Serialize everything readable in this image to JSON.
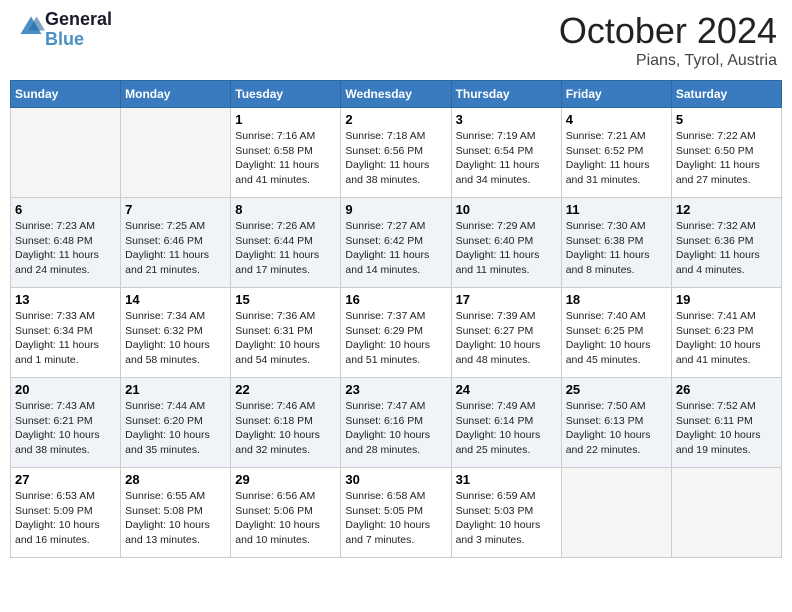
{
  "logo": {
    "text_general": "General",
    "text_blue": "Blue"
  },
  "header": {
    "month": "October 2024",
    "location": "Pians, Tyrol, Austria"
  },
  "weekdays": [
    "Sunday",
    "Monday",
    "Tuesday",
    "Wednesday",
    "Thursday",
    "Friday",
    "Saturday"
  ],
  "weeks": [
    [
      {
        "day": "",
        "info": ""
      },
      {
        "day": "",
        "info": ""
      },
      {
        "day": "1",
        "info": "Sunrise: 7:16 AM\nSunset: 6:58 PM\nDaylight: 11 hours and 41 minutes."
      },
      {
        "day": "2",
        "info": "Sunrise: 7:18 AM\nSunset: 6:56 PM\nDaylight: 11 hours and 38 minutes."
      },
      {
        "day": "3",
        "info": "Sunrise: 7:19 AM\nSunset: 6:54 PM\nDaylight: 11 hours and 34 minutes."
      },
      {
        "day": "4",
        "info": "Sunrise: 7:21 AM\nSunset: 6:52 PM\nDaylight: 11 hours and 31 minutes."
      },
      {
        "day": "5",
        "info": "Sunrise: 7:22 AM\nSunset: 6:50 PM\nDaylight: 11 hours and 27 minutes."
      }
    ],
    [
      {
        "day": "6",
        "info": "Sunrise: 7:23 AM\nSunset: 6:48 PM\nDaylight: 11 hours and 24 minutes."
      },
      {
        "day": "7",
        "info": "Sunrise: 7:25 AM\nSunset: 6:46 PM\nDaylight: 11 hours and 21 minutes."
      },
      {
        "day": "8",
        "info": "Sunrise: 7:26 AM\nSunset: 6:44 PM\nDaylight: 11 hours and 17 minutes."
      },
      {
        "day": "9",
        "info": "Sunrise: 7:27 AM\nSunset: 6:42 PM\nDaylight: 11 hours and 14 minutes."
      },
      {
        "day": "10",
        "info": "Sunrise: 7:29 AM\nSunset: 6:40 PM\nDaylight: 11 hours and 11 minutes."
      },
      {
        "day": "11",
        "info": "Sunrise: 7:30 AM\nSunset: 6:38 PM\nDaylight: 11 hours and 8 minutes."
      },
      {
        "day": "12",
        "info": "Sunrise: 7:32 AM\nSunset: 6:36 PM\nDaylight: 11 hours and 4 minutes."
      }
    ],
    [
      {
        "day": "13",
        "info": "Sunrise: 7:33 AM\nSunset: 6:34 PM\nDaylight: 11 hours and 1 minute."
      },
      {
        "day": "14",
        "info": "Sunrise: 7:34 AM\nSunset: 6:32 PM\nDaylight: 10 hours and 58 minutes."
      },
      {
        "day": "15",
        "info": "Sunrise: 7:36 AM\nSunset: 6:31 PM\nDaylight: 10 hours and 54 minutes."
      },
      {
        "day": "16",
        "info": "Sunrise: 7:37 AM\nSunset: 6:29 PM\nDaylight: 10 hours and 51 minutes."
      },
      {
        "day": "17",
        "info": "Sunrise: 7:39 AM\nSunset: 6:27 PM\nDaylight: 10 hours and 48 minutes."
      },
      {
        "day": "18",
        "info": "Sunrise: 7:40 AM\nSunset: 6:25 PM\nDaylight: 10 hours and 45 minutes."
      },
      {
        "day": "19",
        "info": "Sunrise: 7:41 AM\nSunset: 6:23 PM\nDaylight: 10 hours and 41 minutes."
      }
    ],
    [
      {
        "day": "20",
        "info": "Sunrise: 7:43 AM\nSunset: 6:21 PM\nDaylight: 10 hours and 38 minutes."
      },
      {
        "day": "21",
        "info": "Sunrise: 7:44 AM\nSunset: 6:20 PM\nDaylight: 10 hours and 35 minutes."
      },
      {
        "day": "22",
        "info": "Sunrise: 7:46 AM\nSunset: 6:18 PM\nDaylight: 10 hours and 32 minutes."
      },
      {
        "day": "23",
        "info": "Sunrise: 7:47 AM\nSunset: 6:16 PM\nDaylight: 10 hours and 28 minutes."
      },
      {
        "day": "24",
        "info": "Sunrise: 7:49 AM\nSunset: 6:14 PM\nDaylight: 10 hours and 25 minutes."
      },
      {
        "day": "25",
        "info": "Sunrise: 7:50 AM\nSunset: 6:13 PM\nDaylight: 10 hours and 22 minutes."
      },
      {
        "day": "26",
        "info": "Sunrise: 7:52 AM\nSunset: 6:11 PM\nDaylight: 10 hours and 19 minutes."
      }
    ],
    [
      {
        "day": "27",
        "info": "Sunrise: 6:53 AM\nSunset: 5:09 PM\nDaylight: 10 hours and 16 minutes."
      },
      {
        "day": "28",
        "info": "Sunrise: 6:55 AM\nSunset: 5:08 PM\nDaylight: 10 hours and 13 minutes."
      },
      {
        "day": "29",
        "info": "Sunrise: 6:56 AM\nSunset: 5:06 PM\nDaylight: 10 hours and 10 minutes."
      },
      {
        "day": "30",
        "info": "Sunrise: 6:58 AM\nSunset: 5:05 PM\nDaylight: 10 hours and 7 minutes."
      },
      {
        "day": "31",
        "info": "Sunrise: 6:59 AM\nSunset: 5:03 PM\nDaylight: 10 hours and 3 minutes."
      },
      {
        "day": "",
        "info": ""
      },
      {
        "day": "",
        "info": ""
      }
    ]
  ]
}
